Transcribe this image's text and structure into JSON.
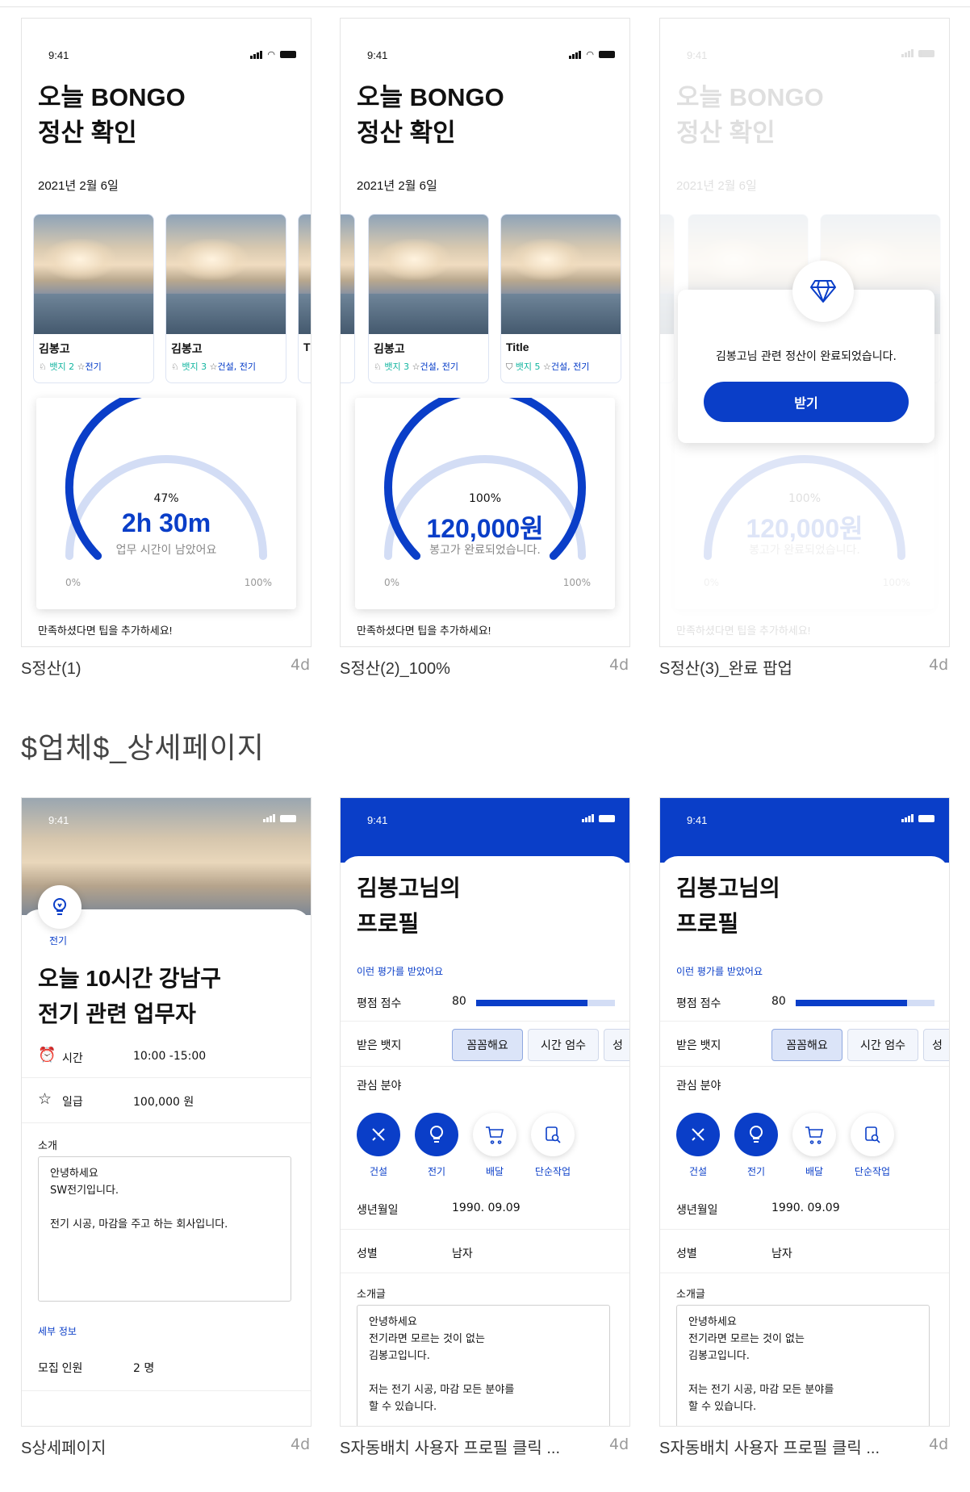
{
  "status_time": "9:41",
  "top_frames": [
    {
      "title_line1": "오늘 BONGO",
      "title_line2": "정산 확인",
      "date": "2021년 2월 6일",
      "cards": [
        {
          "name": "김봉고",
          "badge": "뱃지 2",
          "field": "전기"
        },
        {
          "name": "김봉고",
          "badge": "뱃지 3",
          "field": "건설, 전기"
        },
        {
          "name": "T"
        }
      ],
      "gauge": {
        "percent_label": "47%",
        "fraction": 0.47,
        "value": "2h 30m",
        "sub": "업무 시간이 남았어요",
        "min_label": "0%",
        "max_label": "100%"
      },
      "tip": "만족하셨다면 팁을 추가하세요!",
      "label": "S정산(1)",
      "age": "4d"
    },
    {
      "title_line1": "오늘 BONGO",
      "title_line2": "정산 확인",
      "date": "2021년 2월 6일",
      "cards": [
        {
          "name": "김봉고",
          "badge": "뱃지 3",
          "field": "건설, 전기"
        },
        {
          "name": "Title",
          "badge": "뱃지 5",
          "field": "건설, 전기"
        }
      ],
      "gauge": {
        "percent_label": "100%",
        "fraction": 1.0,
        "value": "120,000원",
        "sub": "봉고가 완료되었습니다.",
        "min_label": "0%",
        "max_label": "100%"
      },
      "tip": "만족하셨다면 팁을 추가하세요!",
      "label": "S정산(2)_100%",
      "age": "4d"
    },
    {
      "title_line1": "오늘 BONGO",
      "title_line2": "정산 확인",
      "date": "2021년 2월 6일",
      "gauge": {
        "percent_label": "100%",
        "value": "120,000원",
        "sub": "봉고가 완료되었습니다.",
        "min_label": "0%",
        "max_label": "100%"
      },
      "tip": "만족하셨다면 팁을 추가하세요!",
      "popup": {
        "message": "김봉고님 관련 정산이 완료되었습니다.",
        "button": "받기"
      },
      "label": "S정산(3)_완료 팝업",
      "age": "4d"
    }
  ],
  "section_title": "$업체$_상세페이지",
  "detail": {
    "category": "전기",
    "title_line1": "오늘 10시간 강남구",
    "title_line2": "전기 관련 업무자",
    "time_label": "시간",
    "time_value": "10:00 -15:00",
    "pay_label": "일급",
    "pay_value": "100,000 원",
    "intro_label": "소개",
    "intro_lines": [
      "안녕하세요",
      "SW전기입니다.",
      "",
      "전기 시공, 마감을 주고 하는 회사입니다."
    ],
    "detail_link": "세부 정보",
    "recruit_label": "모집 인원",
    "recruit_value": "2 명",
    "label": "S상세페이지",
    "age": "4d"
  },
  "profiles": [
    {
      "title_line1": "김봉고님의",
      "title_line2": "프로필",
      "eval_link": "이런 평가를 받았어요",
      "score_label": "평점 점수",
      "score_value": "80",
      "score_fraction": 0.8,
      "badge_label": "받은 뱃지",
      "chips": [
        "꼼꼼해요",
        "시간 엄수",
        "성"
      ],
      "interest_label": "관심 분야",
      "categories": [
        "건설",
        "전기",
        "배달",
        "단순작업"
      ],
      "birth_label": "생년월일",
      "birth_value": "1990. 09.09",
      "gender_label": "성별",
      "gender_value": "남자",
      "intro_label": "소개글",
      "intro_lines": [
        "안녕하세요",
        "전기라면 모르는 것이 없는",
        "김봉고입니다.",
        "",
        "저는 전기 시공, 마감 모든 분야를",
        "할 수 있습니다."
      ],
      "label": "S자동배치 사용자 프로필 클릭 ...",
      "age": "4d"
    },
    {
      "title_line1": "김봉고님의",
      "title_line2": "프로필",
      "eval_link": "이런 평가를 받았어요",
      "score_label": "평점 점수",
      "score_value": "80",
      "score_fraction": 0.8,
      "badge_label": "받은 뱃지",
      "chips": [
        "꼼꼼해요",
        "시간 엄수",
        "성"
      ],
      "interest_label": "관심 분야",
      "categories": [
        "건설",
        "전기",
        "배달",
        "단순작업"
      ],
      "birth_label": "생년월일",
      "birth_value": "1990. 09.09",
      "gender_label": "성별",
      "gender_value": "남자",
      "intro_label": "소개글",
      "intro_lines": [
        "안녕하세요",
        "전기라면 모르는 것이 없는",
        "김봉고입니다.",
        "",
        "저는 전기 시공, 마감 모든 분야를",
        "할 수 있습니다."
      ],
      "label": "S자동배치 사용자 프로필 클릭 ...",
      "age": "4d"
    }
  ],
  "colors": {
    "accent": "#0a3ec8",
    "gauge_track": "#d3ddf5",
    "badge_text": "#12b5a0"
  }
}
